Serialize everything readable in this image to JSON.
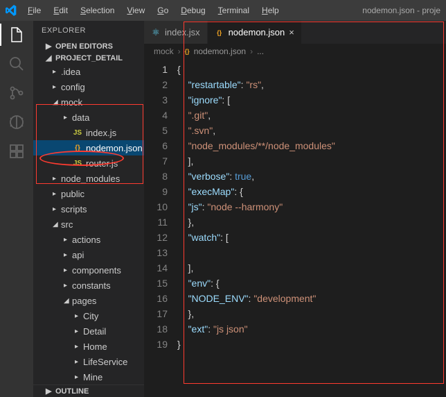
{
  "titlebar": {
    "menus": [
      "File",
      "Edit",
      "Selection",
      "View",
      "Go",
      "Debug",
      "Terminal",
      "Help"
    ],
    "right": "nodemon.json - proje"
  },
  "sidebar": {
    "title": "EXPLORER",
    "sections": {
      "open_editors": "OPEN EDITORS",
      "project": "PROJECT_DETAIL",
      "outline": "OUTLINE"
    },
    "tree": [
      {
        "depth": 1,
        "type": "folder",
        "open": false,
        "label": ".idea"
      },
      {
        "depth": 1,
        "type": "folder",
        "open": false,
        "label": "config"
      },
      {
        "depth": 1,
        "type": "folder",
        "open": true,
        "label": "mock"
      },
      {
        "depth": 2,
        "type": "folder",
        "open": false,
        "label": "data"
      },
      {
        "depth": 2,
        "type": "js",
        "label": "index.js"
      },
      {
        "depth": 2,
        "type": "json",
        "label": "nodemon.json",
        "selected": true
      },
      {
        "depth": 2,
        "type": "js",
        "label": "router.js"
      },
      {
        "depth": 1,
        "type": "folder",
        "open": false,
        "label": "node_modules"
      },
      {
        "depth": 1,
        "type": "folder",
        "open": false,
        "label": "public"
      },
      {
        "depth": 1,
        "type": "folder",
        "open": false,
        "label": "scripts"
      },
      {
        "depth": 1,
        "type": "folder",
        "open": true,
        "label": "src"
      },
      {
        "depth": 2,
        "type": "folder",
        "open": false,
        "label": "actions"
      },
      {
        "depth": 2,
        "type": "folder",
        "open": false,
        "label": "api"
      },
      {
        "depth": 2,
        "type": "folder",
        "open": false,
        "label": "components"
      },
      {
        "depth": 2,
        "type": "folder",
        "open": false,
        "label": "constants"
      },
      {
        "depth": 2,
        "type": "folder",
        "open": true,
        "label": "pages"
      },
      {
        "depth": 3,
        "type": "folder",
        "open": false,
        "label": "City"
      },
      {
        "depth": 3,
        "type": "folder",
        "open": false,
        "label": "Detail"
      },
      {
        "depth": 3,
        "type": "folder",
        "open": false,
        "label": "Home"
      },
      {
        "depth": 3,
        "type": "folder",
        "open": false,
        "label": "LifeService"
      },
      {
        "depth": 3,
        "type": "folder",
        "open": false,
        "label": "Mine"
      }
    ]
  },
  "tabs": [
    {
      "icon": "react",
      "label": "index.jsx",
      "active": false
    },
    {
      "icon": "json",
      "label": "nodemon.json",
      "active": true
    }
  ],
  "breadcrumb": {
    "lead": "mock",
    "file": "nodemon.json",
    "trail": "..."
  },
  "code": {
    "lines": [
      [
        {
          "t": "p",
          "v": "{"
        }
      ],
      [
        {
          "t": "p",
          "v": "    "
        },
        {
          "t": "k",
          "v": "\"restartable\""
        },
        {
          "t": "p",
          "v": ": "
        },
        {
          "t": "s",
          "v": "\"rs\""
        },
        {
          "t": "p",
          "v": ","
        }
      ],
      [
        {
          "t": "p",
          "v": "    "
        },
        {
          "t": "k",
          "v": "\"ignore\""
        },
        {
          "t": "p",
          "v": ": ["
        }
      ],
      [
        {
          "t": "p",
          "v": "    "
        },
        {
          "t": "s",
          "v": "\".git\""
        },
        {
          "t": "p",
          "v": ","
        }
      ],
      [
        {
          "t": "p",
          "v": "    "
        },
        {
          "t": "s",
          "v": "\".svn\""
        },
        {
          "t": "p",
          "v": ","
        }
      ],
      [
        {
          "t": "p",
          "v": "    "
        },
        {
          "t": "s",
          "v": "\"node_modules/**/node_modules\""
        }
      ],
      [
        {
          "t": "p",
          "v": "    ],"
        }
      ],
      [
        {
          "t": "p",
          "v": "    "
        },
        {
          "t": "k",
          "v": "\"verbose\""
        },
        {
          "t": "p",
          "v": ": "
        },
        {
          "t": "b",
          "v": "true"
        },
        {
          "t": "p",
          "v": ","
        }
      ],
      [
        {
          "t": "p",
          "v": "    "
        },
        {
          "t": "k",
          "v": "\"execMap\""
        },
        {
          "t": "p",
          "v": ": {"
        }
      ],
      [
        {
          "t": "p",
          "v": "    "
        },
        {
          "t": "k",
          "v": "\"js\""
        },
        {
          "t": "p",
          "v": ": "
        },
        {
          "t": "s",
          "v": "\"node --harmony\""
        }
      ],
      [
        {
          "t": "p",
          "v": "    },"
        }
      ],
      [
        {
          "t": "p",
          "v": "    "
        },
        {
          "t": "k",
          "v": "\"watch\""
        },
        {
          "t": "p",
          "v": ": ["
        }
      ],
      [],
      [
        {
          "t": "p",
          "v": "    ],"
        }
      ],
      [
        {
          "t": "p",
          "v": "    "
        },
        {
          "t": "k",
          "v": "\"env\""
        },
        {
          "t": "p",
          "v": ": {"
        }
      ],
      [
        {
          "t": "p",
          "v": "    "
        },
        {
          "t": "k",
          "v": "\"NODE_ENV\""
        },
        {
          "t": "p",
          "v": ": "
        },
        {
          "t": "s",
          "v": "\"development\""
        }
      ],
      [
        {
          "t": "p",
          "v": "    },"
        }
      ],
      [
        {
          "t": "p",
          "v": "    "
        },
        {
          "t": "k",
          "v": "\"ext\""
        },
        {
          "t": "p",
          "v": ": "
        },
        {
          "t": "s",
          "v": "\"js json\""
        }
      ],
      [
        {
          "t": "p",
          "v": "}"
        }
      ]
    ]
  }
}
